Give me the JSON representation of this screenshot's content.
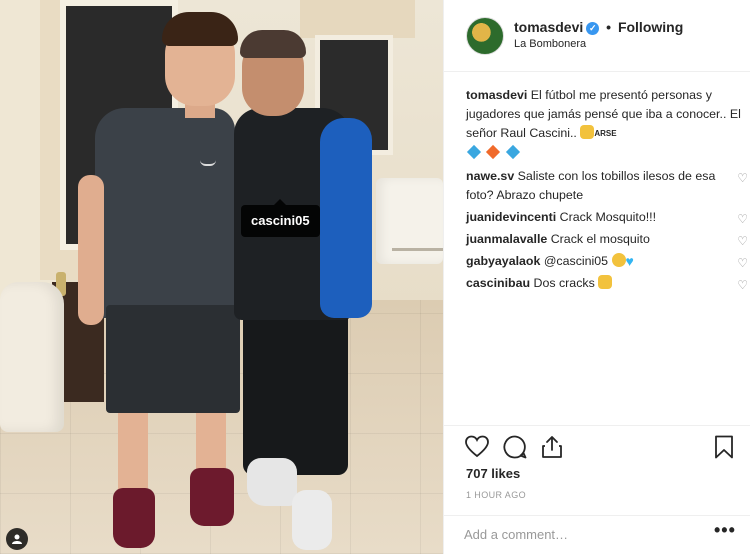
{
  "photo": {
    "tag_label": "cascini05"
  },
  "header": {
    "username": "tomasdevi",
    "separator": "•",
    "follow_status": "Following",
    "location": "La Bombonera"
  },
  "caption": {
    "username": "tomasdevi",
    "text": "El fútbol me presentó personas y jugadores que jamás pensé que iba a conocer.. El señor Raul Cascini..",
    "badge": "ARSE",
    "diamond_colors": [
      "#3aa7e0",
      "#f06a2b",
      "#3aa7e0"
    ]
  },
  "comments": [
    {
      "username": "nawe.sv",
      "text": "Saliste con los tobillos ilesos de esa foto? Abrazo chupete"
    },
    {
      "username": "juanidevincenti",
      "text": "Crack Mosquito!!!"
    },
    {
      "username": "juanmalavalle",
      "text": "Crack el mosquito"
    },
    {
      "username": "gabyayalaok",
      "text": "@cascini05"
    },
    {
      "username": "cascinibau",
      "text": "Dos cracks"
    }
  ],
  "actions": {
    "likes": "707 likes",
    "time": "1 HOUR AGO"
  },
  "comment_box": {
    "placeholder": "Add a comment…",
    "more": "•••"
  },
  "icons": {
    "heart": "heart-icon",
    "comment": "comment-icon",
    "share": "share-icon",
    "save": "bookmark-icon",
    "verified": "verified-badge-icon",
    "user_tag": "user-tag-icon"
  },
  "colors": {
    "verified": "#3897f0",
    "text": "#262626",
    "muted": "#999999"
  }
}
